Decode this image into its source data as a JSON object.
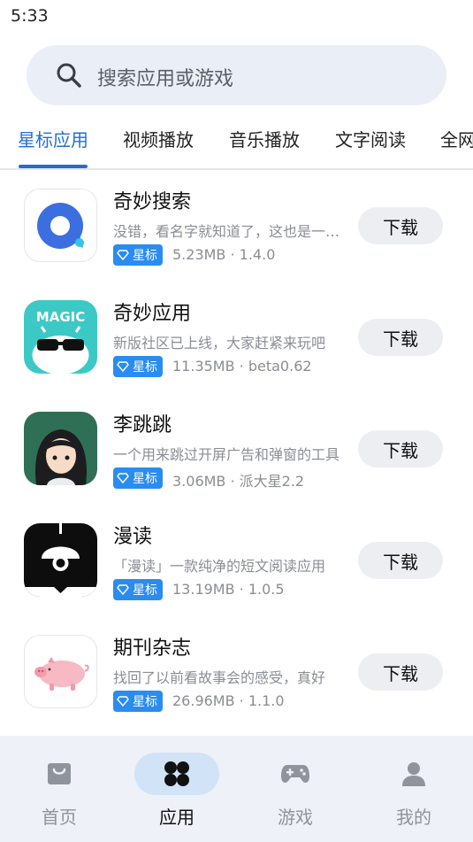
{
  "status_bar": {
    "time": "5:33"
  },
  "search": {
    "placeholder": "搜索应用或游戏"
  },
  "tabs": [
    {
      "label": "星标应用",
      "active": true
    },
    {
      "label": "视频播放"
    },
    {
      "label": "音乐播放"
    },
    {
      "label": "文字阅读"
    },
    {
      "label": "全网"
    }
  ],
  "apps": [
    {
      "name": "奇妙搜索",
      "desc": "没错，看名字就知道了，这也是一款奇妙系列软件",
      "badge": "星标",
      "meta": "5.23MB · 1.4.0",
      "button": "下载",
      "icon": "search-app-icon"
    },
    {
      "name": "奇妙应用",
      "desc": "新版社区已上线，大家赶紧来玩吧",
      "badge": "星标",
      "meta": "11.35MB · beta0.62",
      "button": "下载",
      "icon": "magic-app-icon",
      "icon_text": "MAGIC"
    },
    {
      "name": "李跳跳",
      "desc": "一个用来跳过开屏广告和弹窗的工具",
      "badge": "星标",
      "meta": "3.06MB · 派大星2.2",
      "button": "下载",
      "icon": "girl-avatar-icon"
    },
    {
      "name": "漫读",
      "desc": "「漫读」一款纯净的短文阅读应用",
      "badge": "星标",
      "meta": "13.19MB · 1.0.5",
      "button": "下载",
      "icon": "lamp-icon"
    },
    {
      "name": "期刊杂志",
      "desc": "找回了以前看故事会的感受，真好",
      "badge": "星标",
      "meta": "26.96MB · 1.1.0",
      "button": "下载",
      "icon": "pig-icon"
    }
  ],
  "bottom_nav": [
    {
      "label": "首页",
      "icon": "home-bag-icon"
    },
    {
      "label": "应用",
      "icon": "apps-grid-icon",
      "active": true
    },
    {
      "label": "游戏",
      "icon": "gamepad-icon"
    },
    {
      "label": "我的",
      "icon": "person-icon"
    }
  ],
  "colors": {
    "accent": "#1f6fd6",
    "badge": "#2b8cf0",
    "search_bg": "#e9eef7",
    "nav_bg": "#eef1f7"
  }
}
